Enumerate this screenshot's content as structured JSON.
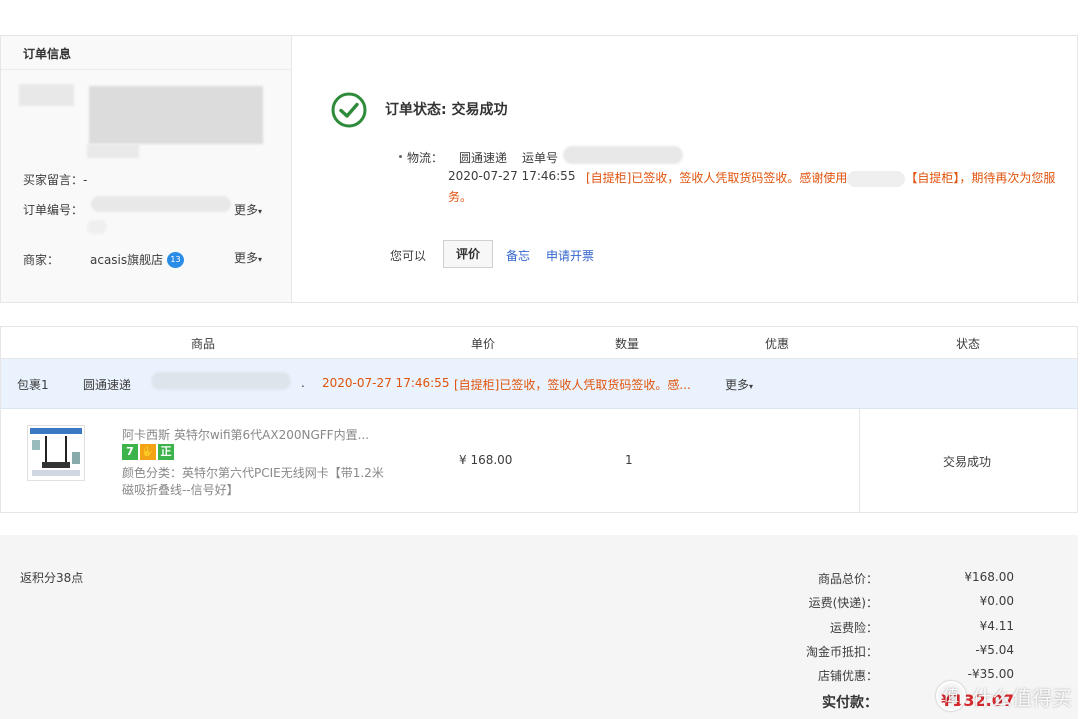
{
  "order_info": {
    "title": "订单信息",
    "buyer_note_label": "买家留言：",
    "buyer_note_value": "-",
    "order_no_label": "订单编号：",
    "more_label": "更多",
    "seller_label": "商家：",
    "seller_name": "acasis旗舰店",
    "seller_badge": "13"
  },
  "status": {
    "title": "订单状态: 交易成功",
    "logistics_label": "物流：",
    "company": "圆通速递",
    "tracking_label": "运单号",
    "time": "2020-07-27 17:46:55",
    "message_part1": "[自提柜]已签收，签收人凭取货码签收。感谢使用",
    "message_part2": "【自提柜】，期待再次为您服务。",
    "actions_label": "您可以",
    "review_button": "评价",
    "memo_link": "备忘",
    "invoice_link": "申请开票"
  },
  "table": {
    "headers": [
      "商品",
      "单价",
      "数量",
      "优惠",
      "状态"
    ],
    "package": {
      "label": "包裹1",
      "company": "圆通速递",
      "dot": ".",
      "time": "2020-07-27 17:46:55",
      "message": "[自提柜]已签收，签收人凭取货码签收。感...",
      "more_label": "更多"
    },
    "item": {
      "title": "阿卡西斯 英特尔wifi第6代AX200NGFF内置...",
      "badges": [
        "7",
        "✋",
        "正"
      ],
      "sku": "颜色分类：英特尔第六代PCIE无线网卡【带1.2米磁吸折叠线--信号好】",
      "price": "¥ 168.00",
      "qty": "1",
      "status": "交易成功"
    }
  },
  "summary": {
    "points": "返积分38点",
    "goods_total_label": "商品总价：",
    "goods_total": "¥168.00",
    "shipping_label": "运费(快递)：",
    "shipping": "¥0.00",
    "insurance_label": "运费险：",
    "insurance": "¥4.11",
    "coin_label": "淘金币抵扣：",
    "coin": "-¥5.04",
    "shop_discount_label": "店铺优惠：",
    "shop_discount": "-¥35.00",
    "paid_label": "实付款：",
    "paid": "¥132.07"
  },
  "watermark": {
    "icon_char": "值",
    "text": "什么值得买"
  },
  "colors": {
    "orange": "#e0530c",
    "blue_link": "#3366cc",
    "success_green": "#2e8b3a",
    "badge_green": "#3cb44b",
    "badge_orange": "#f4a314"
  }
}
